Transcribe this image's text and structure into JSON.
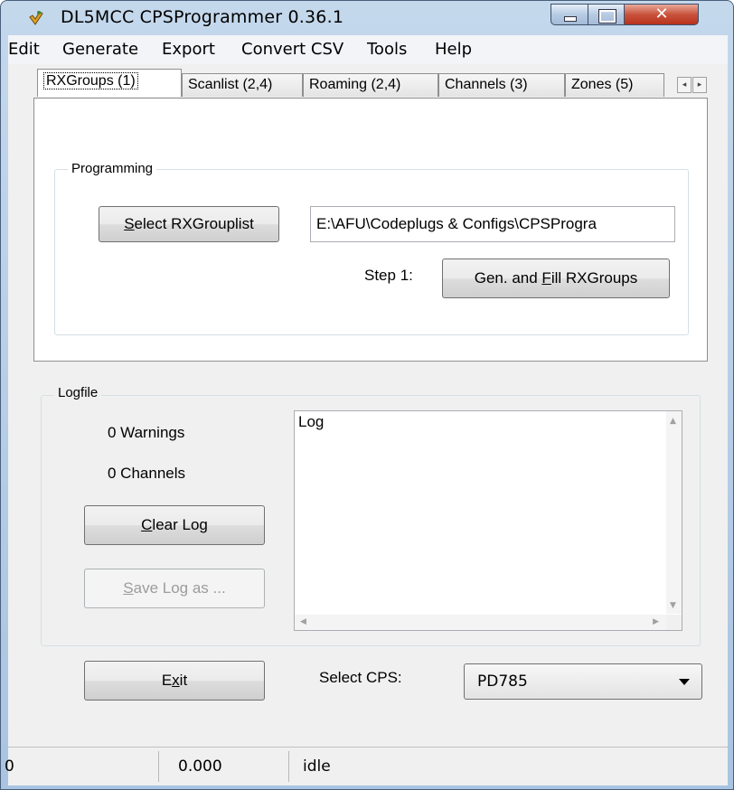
{
  "window": {
    "title": "DL5MCC CPSProgrammer 0.36.1",
    "close_glyph": "✕"
  },
  "menu": [
    "Edit",
    "Generate",
    "Export",
    "Convert CSV",
    "Tools",
    "Help"
  ],
  "tabs": [
    "RXGroups (1)",
    "Scanlist (2,4)",
    "Roaming (2,4)",
    "Channels (3)",
    "Zones (5)"
  ],
  "tab_scroll": {
    "left": "◂",
    "right": "▸"
  },
  "programming": {
    "group_label": "Programming",
    "select_button": {
      "pre": "",
      "key": "S",
      "post": "elect RXGrouplist"
    },
    "path_value": "E:\\AFU\\Codeplugs & Configs\\CPSProgra",
    "step_label": "Step 1:",
    "gen_button": {
      "pre": "Gen. and ",
      "key": "F",
      "post": "ill RXGroups"
    }
  },
  "logfile": {
    "group_label": "Logfile",
    "warnings": "0 Warnings",
    "channels": "0 Channels",
    "clear_button": {
      "pre": "",
      "key": "C",
      "post": "lear Log"
    },
    "save_button": {
      "pre": "",
      "key": "S",
      "post": "ave Log as ..."
    },
    "log_text": "Log"
  },
  "bottom": {
    "exit_button": {
      "pre": "E",
      "key": "x",
      "post": "it"
    },
    "select_cps_label": "Select CPS:",
    "cps_value": "PD785"
  },
  "statusbar": [
    "0",
    "0.000",
    "idle"
  ],
  "colors": {
    "accent_tab_border": "#8e8f8f",
    "title_bar": "#c4d8ec",
    "close_button": "#c9533c"
  }
}
